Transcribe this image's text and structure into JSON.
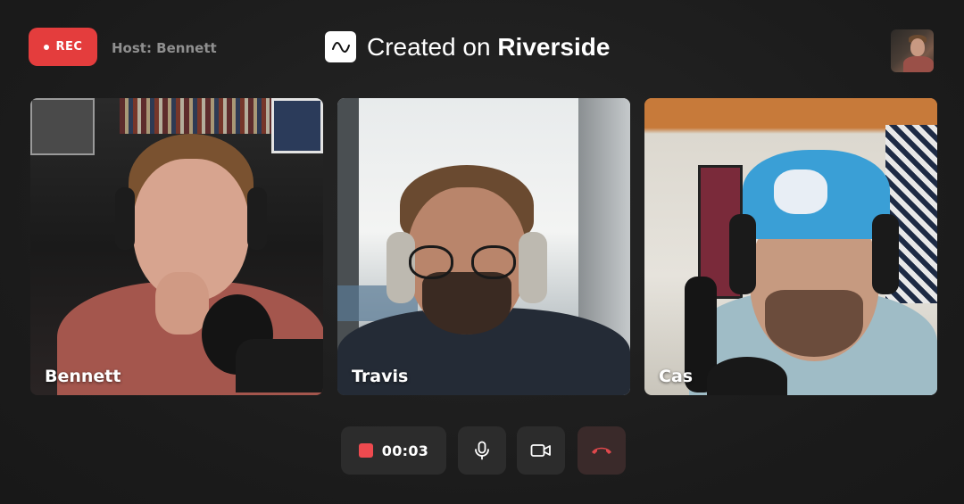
{
  "header": {
    "rec_label": "REC",
    "host_text": "Host: Bennett",
    "brand_prefix": "Created on ",
    "brand_name": "Riverside"
  },
  "participants": [
    {
      "name": "Bennett"
    },
    {
      "name": "Travis"
    },
    {
      "name": "Cas"
    }
  ],
  "controls": {
    "timer": "00:03"
  },
  "colors": {
    "record_red": "#e43d3d",
    "stop_red": "#ee4a4f",
    "leave_red": "#e0484c",
    "control_bg": "#2c2c2c",
    "background": "#1e1e1e"
  },
  "icons": {
    "brand": "waveform-logo-icon",
    "mic": "microphone-icon",
    "camera": "video-camera-icon",
    "leave": "phone-hangup-icon",
    "stop": "stop-square-icon"
  }
}
